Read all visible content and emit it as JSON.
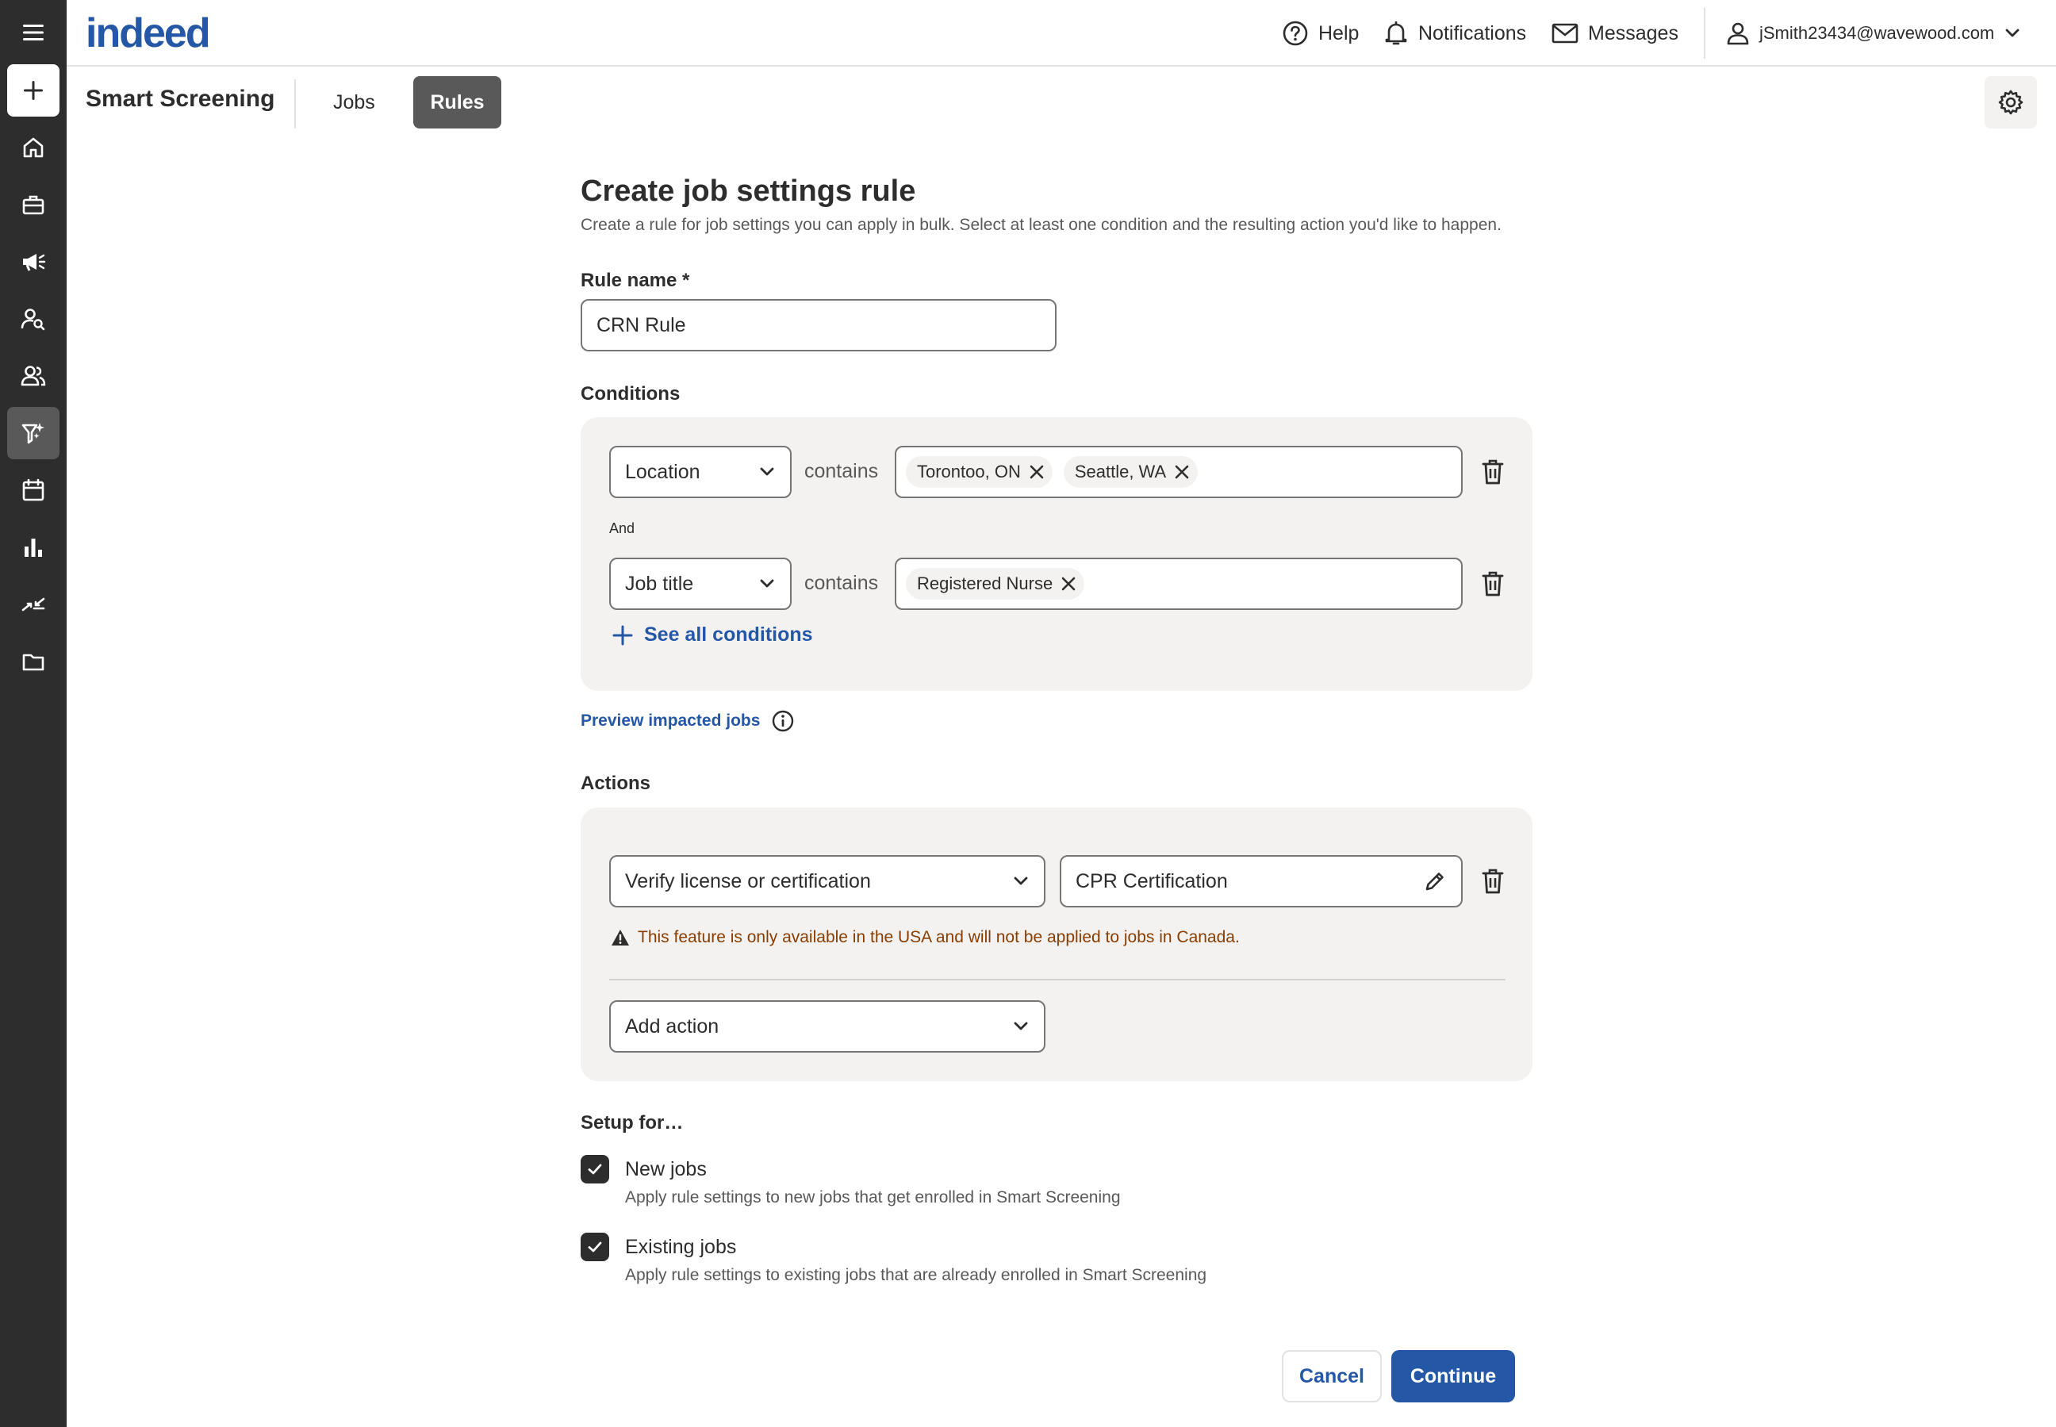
{
  "brand": {
    "logo_text": "indeed",
    "logo_color": "#2557a7"
  },
  "topbar": {
    "help": "Help",
    "notifications": "Notifications",
    "messages": "Messages",
    "account_email": "jSmith23434@wavewood.com"
  },
  "rail": {
    "items": [
      "menu-icon",
      "plus-icon",
      "home-icon",
      "briefcase-icon",
      "megaphone-icon",
      "candidate-search-icon",
      "people-icon",
      "smart-screening-icon",
      "calendar-icon",
      "analytics-icon",
      "integrations-icon",
      "folder-icon"
    ],
    "active": "smart-screening-icon"
  },
  "subheader": {
    "app_title": "Smart Screening",
    "tabs": [
      {
        "label": "Jobs",
        "selected": false
      },
      {
        "label": "Rules",
        "selected": true
      }
    ]
  },
  "form": {
    "title": "Create job settings rule",
    "subtitle": "Create a rule for job settings you can apply in bulk. Select at least one condition and the resulting action you'd like to happen.",
    "rule_name_label": "Rule name *",
    "rule_name_value": "CRN Rule",
    "conditions_label": "Conditions",
    "conditions": [
      {
        "field": "Location",
        "operator": "contains",
        "values": [
          "Torontoo, ON",
          "Seattle, WA"
        ]
      },
      {
        "connector": "And",
        "field": "Job title",
        "operator": "contains",
        "values": [
          "Registered Nurse"
        ]
      }
    ],
    "see_all_conditions": "See all conditions",
    "preview_link": "Preview impacted jobs",
    "actions_label": "Actions",
    "action": {
      "type": "Verify license or certification",
      "value": "CPR Certification",
      "warning": "This feature is only available in the USA and will not be applied to jobs in Canada."
    },
    "add_action_placeholder": "Add action",
    "setup_label": "Setup for…",
    "setup_options": [
      {
        "title": "New jobs",
        "description": "Apply rule settings to new jobs that get enrolled in Smart Screening",
        "checked": true
      },
      {
        "title": "Existing jobs",
        "description": "Apply rule settings to existing jobs that are already enrolled in Smart Screening",
        "checked": true
      }
    ],
    "cancel_label": "Cancel",
    "continue_label": "Continue"
  },
  "colors": {
    "accent": "#2557a7",
    "rail": "#2d2d2d",
    "panel": "#f3f2f1",
    "warning": "#8a3d00"
  }
}
